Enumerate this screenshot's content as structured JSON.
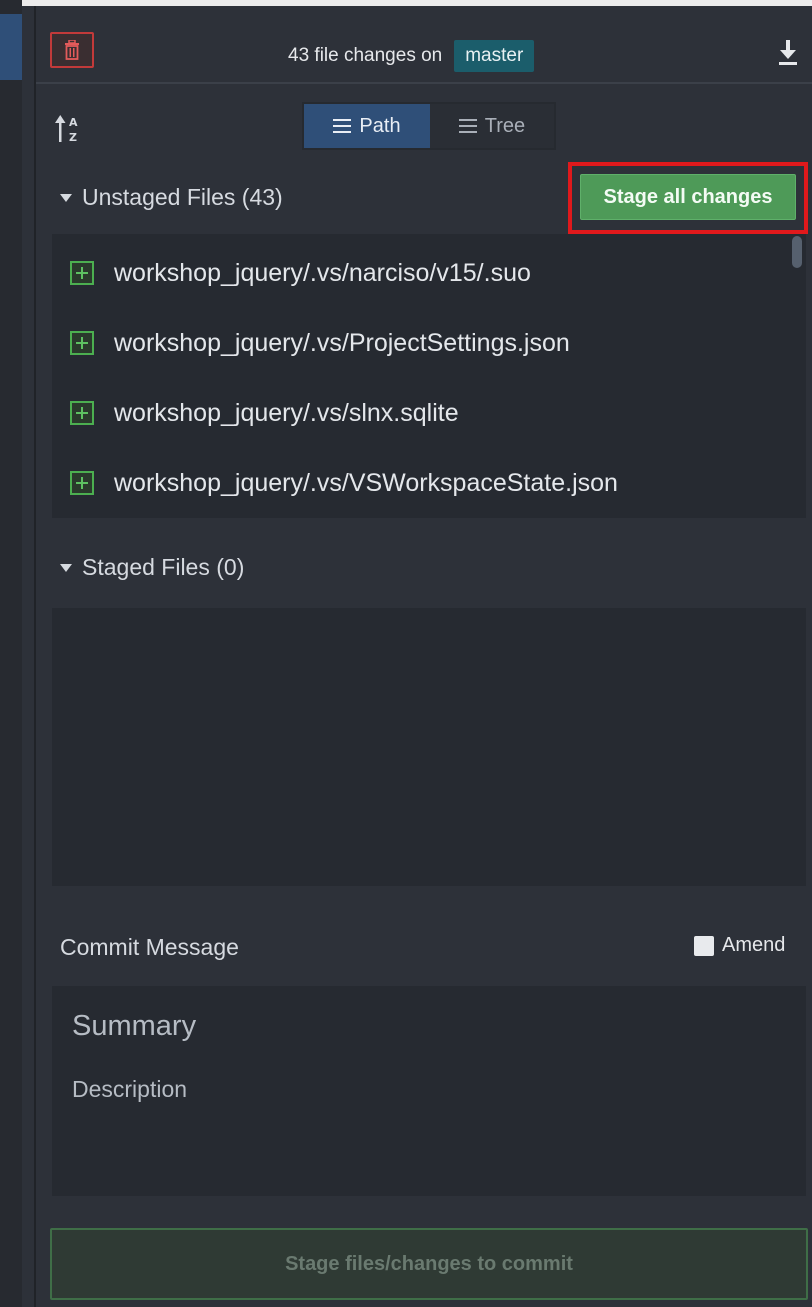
{
  "header": {
    "change_prefix": "43 file changes on",
    "branch": "master"
  },
  "toolbar": {
    "view_path": "Path",
    "view_tree": "Tree",
    "active_view": "Path"
  },
  "unstaged": {
    "title": "Unstaged Files (43)",
    "stage_all_label": "Stage all changes",
    "files": [
      "workshop_jquery/.vs/narciso/v15/.suo",
      "workshop_jquery/.vs/ProjectSettings.json",
      "workshop_jquery/.vs/slnx.sqlite",
      "workshop_jquery/.vs/VSWorkspaceState.json"
    ]
  },
  "staged": {
    "title": "Staged Files (0)"
  },
  "commit": {
    "label": "Commit Message",
    "amend_label": "Amend",
    "summary_placeholder": "Summary",
    "description_placeholder": "Description",
    "submit_label": "Stage files/changes to commit"
  },
  "colors": {
    "accent_blue": "#2f4f78",
    "branch_teal": "#1b5d6b",
    "stage_green": "#4e9a58",
    "highlight_red": "#e0191c",
    "trash_red": "#c23a3a"
  },
  "icons": {
    "discard": "trash-icon",
    "download": "download-icon",
    "sort": "sort-az-icon",
    "file_added": "plus-square-icon"
  }
}
